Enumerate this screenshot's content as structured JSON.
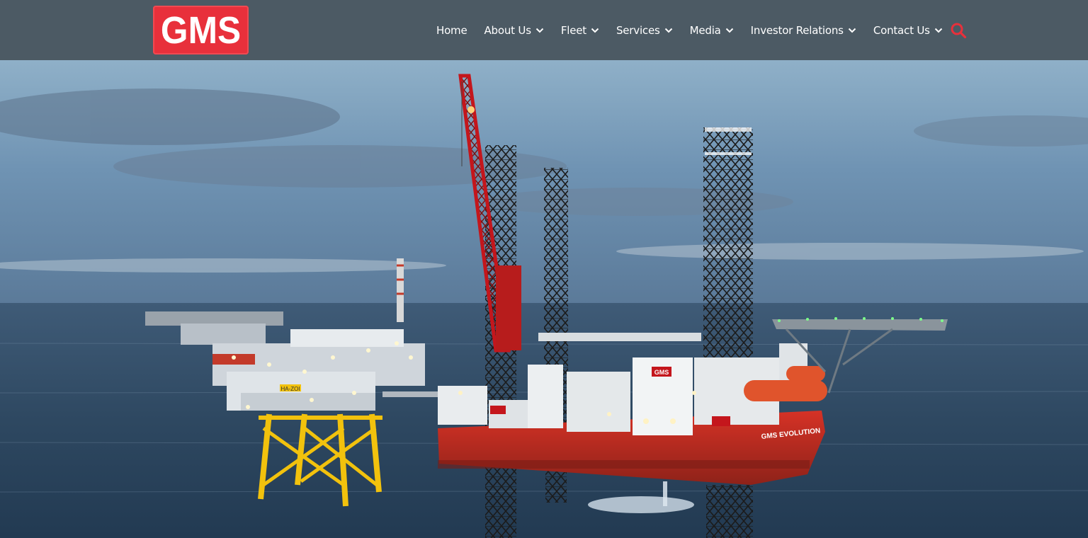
{
  "logo": {
    "text": "GMS"
  },
  "nav": {
    "items": [
      {
        "label": "Home",
        "dropdown": false
      },
      {
        "label": "About Us",
        "dropdown": true
      },
      {
        "label": "Fleet",
        "dropdown": true
      },
      {
        "label": "Services",
        "dropdown": true
      },
      {
        "label": "Media",
        "dropdown": true
      },
      {
        "label": "Investor Relations",
        "dropdown": true
      },
      {
        "label": "Contact Us",
        "dropdown": true
      }
    ],
    "search_icon": "search-icon"
  },
  "hero": {
    "vessel_name": "GMS EVOLUTION",
    "platform_tag": "HA-ZOI",
    "hull_badge": "GMS"
  },
  "colors": {
    "header_bg": "#4c5a64",
    "logo_bg": "#e8303b",
    "accent_search": "#e8303b",
    "hull_red": "#c8281f",
    "jacket_yellow": "#f2c20d"
  }
}
